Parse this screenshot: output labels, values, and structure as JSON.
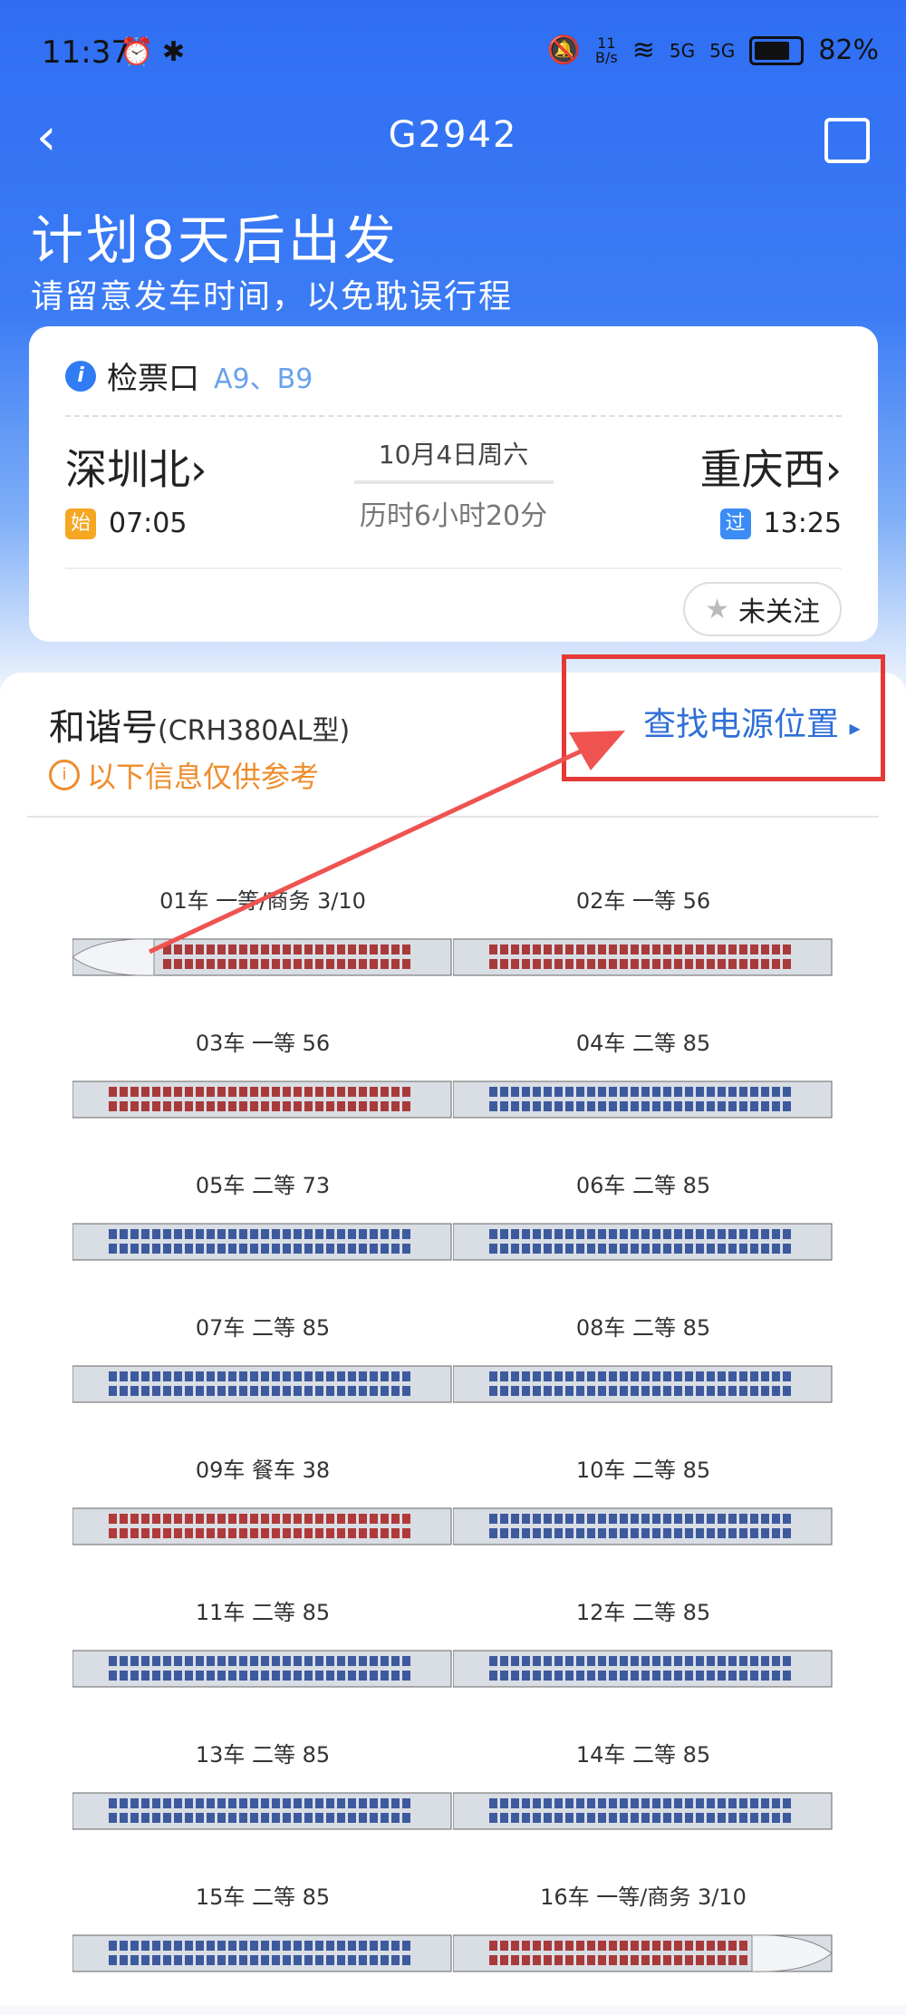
{
  "status_bar": {
    "time": "11:37",
    "speed_top": "11",
    "speed_bottom": "B/s",
    "network_a": "5G",
    "network_b": "5G",
    "battery": "82%"
  },
  "header": {
    "train_no": "G2942",
    "back_icon": "back-arrow-icon",
    "share_icon": "share-icon"
  },
  "notice": {
    "headline": "计划8天后出发",
    "subline": "请留意发车时间，以免耽误行程"
  },
  "trip": {
    "gate_label": "检票口",
    "gate_value": "A9、B9",
    "from": "深圳北›",
    "to": "重庆西›",
    "date": "10月4日周六",
    "duration": "历时6小时20分",
    "from_tag": "始",
    "from_time": "07:05",
    "to_tag": "过",
    "to_time": "13:25",
    "follow_label": "未关注",
    "colors": {
      "from_tag": "#f5a623",
      "to_tag": "#3b8cf5"
    }
  },
  "train": {
    "model_name": "和谐号",
    "model_code": "(CRH380AL型)",
    "note": "以下信息仅供参考",
    "power_link": "查找电源位置",
    "power_arrow": "▸"
  },
  "cars": [
    {
      "label": "01车 一等/商务 3/10",
      "type": "head"
    },
    {
      "label": "02车 一等 56",
      "type": "first"
    },
    {
      "label": "03车 一等 56",
      "type": "first"
    },
    {
      "label": "04车 二等 85",
      "type": "second"
    },
    {
      "label": "05车 二等 73",
      "type": "second"
    },
    {
      "label": "06车 二等 85",
      "type": "second"
    },
    {
      "label": "07车 二等 85",
      "type": "second"
    },
    {
      "label": "08车 二等 85",
      "type": "second"
    },
    {
      "label": "09车 餐车 38",
      "type": "dining"
    },
    {
      "label": "10车 二等 85",
      "type": "second"
    },
    {
      "label": "11车 二等 85",
      "type": "second"
    },
    {
      "label": "12车 二等 85",
      "type": "second"
    },
    {
      "label": "13车 二等 85",
      "type": "second"
    },
    {
      "label": "14车 二等 85",
      "type": "second"
    },
    {
      "label": "15车 二等 85",
      "type": "second"
    },
    {
      "label": "16车 一等/商务 3/10",
      "type": "tail"
    }
  ]
}
